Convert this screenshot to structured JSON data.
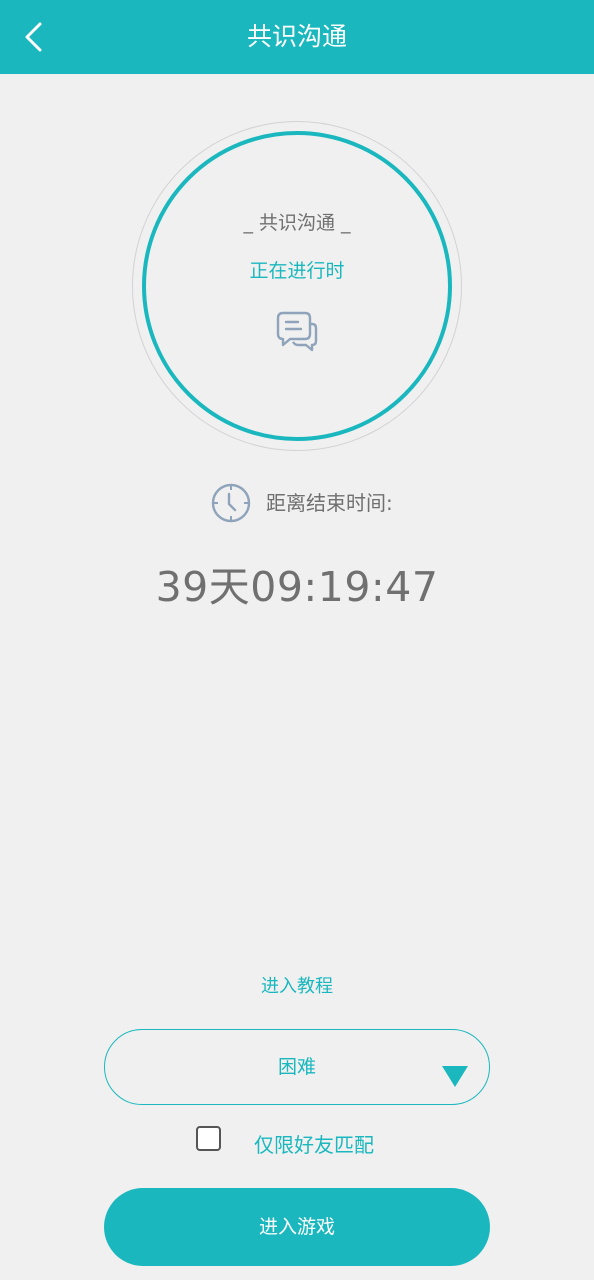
{
  "colors": {
    "accent": "#1ab8be",
    "background": "#f0f0f0",
    "text_gray": "#707070",
    "icon_gray": "#8fa3bb"
  },
  "header": {
    "title": "共识沟通",
    "back_icon": "chevron-left-icon"
  },
  "status_circle": {
    "title": "_ 共识沟通 _",
    "status": "正在进行时",
    "icon": "chat-bubbles-icon"
  },
  "countdown": {
    "icon": "clock-icon",
    "label": "距离结束时间:",
    "value": "39天09:19:47"
  },
  "tutorial": {
    "label": "进入教程"
  },
  "difficulty": {
    "selected": "困难",
    "arrow_icon": "triangle-down-icon"
  },
  "friends_only": {
    "label": "仅限好友匹配",
    "checked": false
  },
  "enter_game": {
    "label": "进入游戏"
  }
}
